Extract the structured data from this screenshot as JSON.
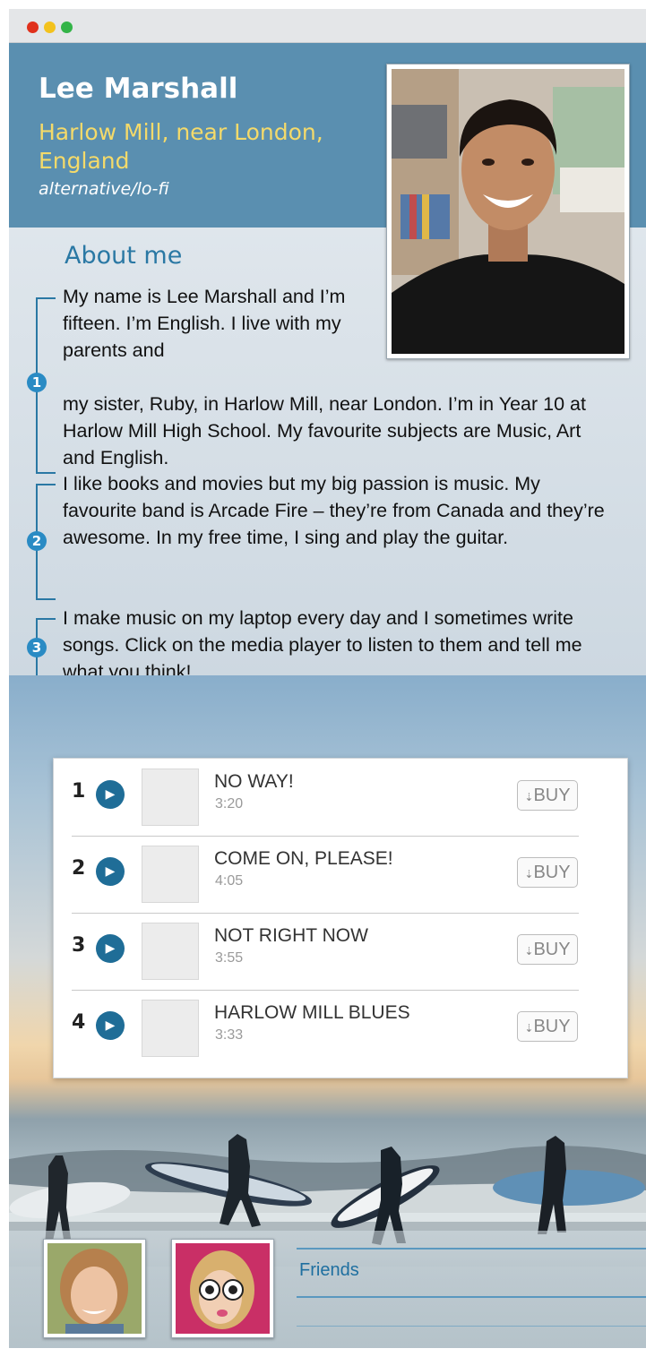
{
  "window": {
    "controls": [
      "close",
      "minimize",
      "zoom"
    ]
  },
  "profile": {
    "name": "Lee Marshall",
    "location": "Harlow Mill, near London, England",
    "genre": "alternative/lo-fi"
  },
  "about": {
    "heading": "About me",
    "paragraph_numbers": [
      "1",
      "2",
      "3"
    ],
    "p1_top": "My name is Lee Marshall and I’m fifteen. I’m English. I live with my parents and",
    "p1_rest": "my sister, Ruby, in Harlow Mill, near London. I’m in Year 10 at Harlow Mill High School. My favourite subjects are Music, Art and English.",
    "p2": "I like books and movies but my big passion is music. My favourite band is Arcade Fire – they’re from Canada and they’re awesome. In my free time, I sing and play the guitar.",
    "p3": "I make music on my laptop every day and I sometimes write songs. Click on the media player to listen to them and tell me what you think!"
  },
  "player": {
    "buy_label": "BUY",
    "tracks": [
      {
        "number": "1",
        "title": "NO WAY!",
        "duration": "3:20"
      },
      {
        "number": "2",
        "title": "COME ON, PLEASE!",
        "duration": "4:05"
      },
      {
        "number": "3",
        "title": "NOT RIGHT NOW",
        "duration": "3:55"
      },
      {
        "number": "4",
        "title": "HARLOW MILL BLUES",
        "duration": "3:33"
      }
    ]
  },
  "friends": {
    "label": "Friends"
  },
  "colors": {
    "header_bg": "#5a8fb0",
    "accent_blue": "#2a78a4",
    "location_yellow": "#f4da6a",
    "play_button": "#1f6d97"
  },
  "icons": {
    "play": "play-icon",
    "download": "download-arrow-icon"
  }
}
